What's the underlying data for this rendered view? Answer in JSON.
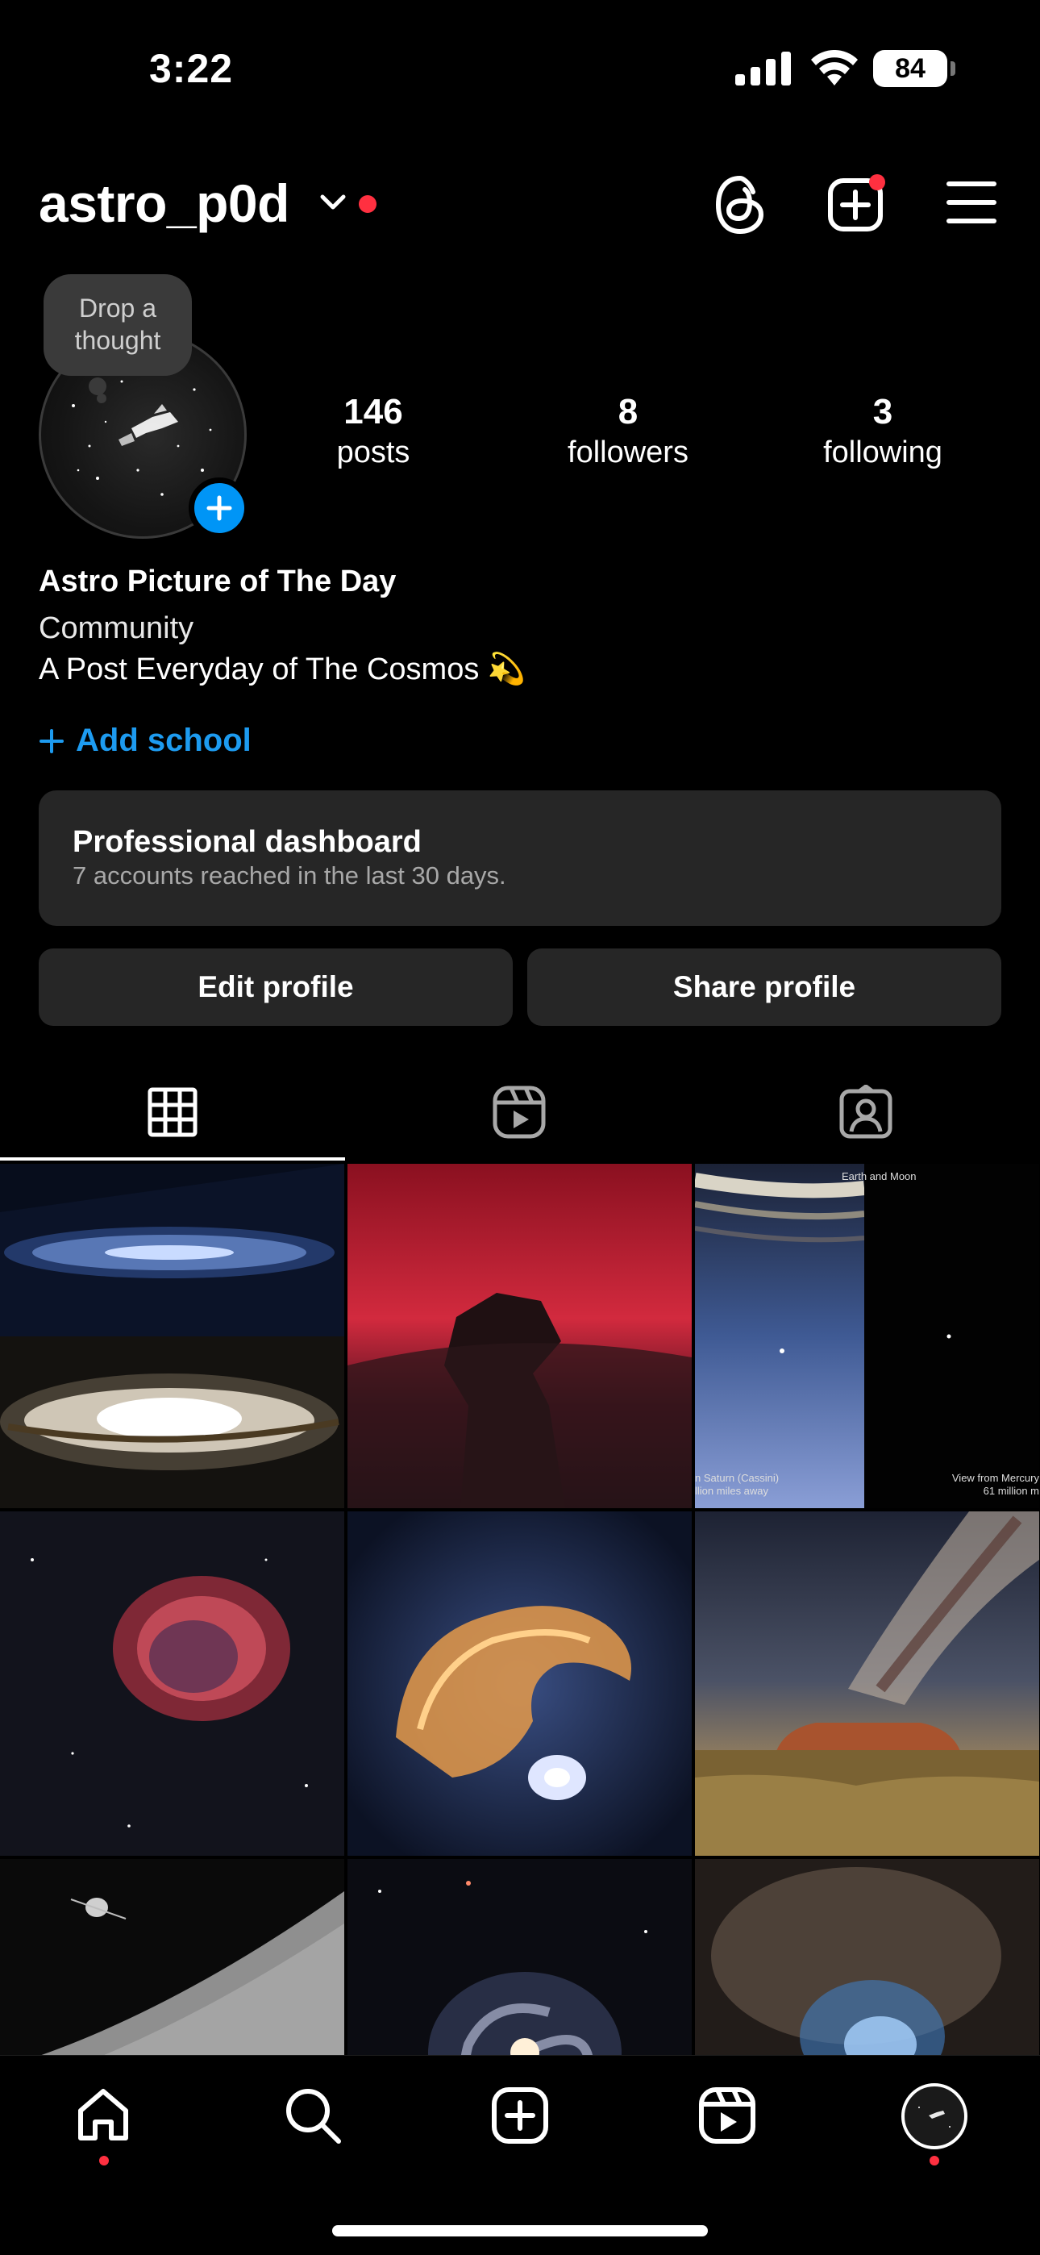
{
  "status_bar": {
    "time": "3:22",
    "battery": "84"
  },
  "header": {
    "username": "astro_p0d"
  },
  "profile": {
    "note_bubble": "Drop a thought",
    "stats": {
      "posts": {
        "count": "146",
        "label": "posts"
      },
      "followers": {
        "count": "8",
        "label": "followers"
      },
      "following": {
        "count": "3",
        "label": "following"
      }
    },
    "display_name": "Astro Picture of The Day",
    "category": "Community",
    "bio": "A Post Everyday of The Cosmos",
    "bio_emoji": "💫",
    "add_school": "Add school"
  },
  "dashboard": {
    "title": "Professional dashboard",
    "subtitle": "7 accounts reached in the last 30 days."
  },
  "buttons": {
    "edit": "Edit profile",
    "share": "Share profile"
  },
  "tabs": [
    "grid-posts",
    "reels",
    "tagged"
  ],
  "grid_captions": {
    "cell3_top": "Earth and Moon",
    "cell3_left_line1": "n Saturn (Cassini)",
    "cell3_left_line2": "llion miles away",
    "cell3_right_line1": "View from Mercury",
    "cell3_right_line2": "61 million m"
  },
  "bottom_nav": [
    "home",
    "search",
    "create",
    "reels",
    "profile"
  ],
  "colors": {
    "accent": "#0095f6",
    "link": "#1d9bf0",
    "notification": "#ff3040",
    "card": "#262626"
  }
}
